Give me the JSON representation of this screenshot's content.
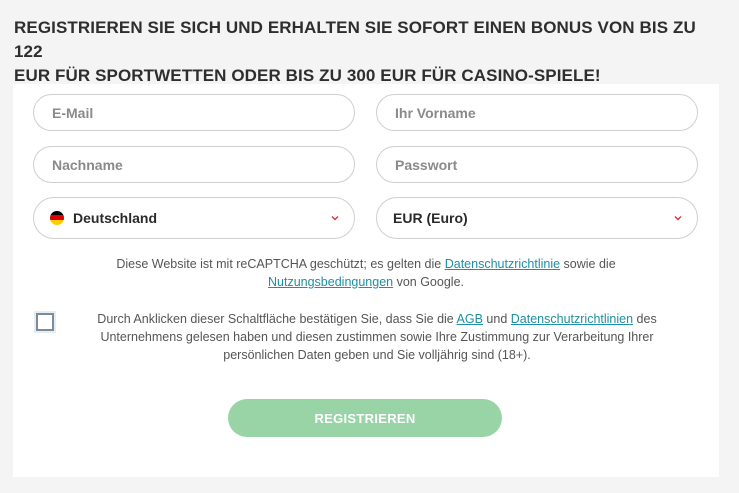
{
  "headline": {
    "line1": "REGISTRIEREN SIE SICH UND ERHALTEN SIE SOFORT EINEN BONUS VON BIS ZU 122",
    "line2": "EUR FÜR SPORTWETTEN ODER BIS ZU 300 EUR FÜR CASINO-SPIELE!"
  },
  "form": {
    "email_placeholder": "E-Mail",
    "firstname_placeholder": "Ihr Vorname",
    "lastname_placeholder": "Nachname",
    "password_placeholder": "Passwort",
    "country_value": "Deutschland",
    "currency_value": "EUR (Euro)",
    "register_label": "REGISTRIEREN"
  },
  "recaptcha": {
    "prefix": "Diese Website ist mit reCAPTCHA geschützt; es gelten die ",
    "privacy_link": "Datenschutzrichtlinie",
    "middle": " sowie die",
    "terms_link": "Nutzungsbedingungen",
    "suffix": " von Google."
  },
  "consent": {
    "prefix": "Durch Anklicken dieser Schaltfläche bestätigen Sie, dass Sie die ",
    "agb_link": "AGB",
    "and": " und ",
    "privacy_link": "Datenschutzrichtlinien",
    "suffix_line1": " des",
    "line2": "Unternehmens gelesen haben und diesen zustimmen sowie Ihre Zustimmung zur Verarbeitung Ihrer",
    "line3": "persönlichen Daten geben und Sie volljährig sind (18+)."
  },
  "colors": {
    "accent_link": "#1f8fa2",
    "register_button": "#98d4a6",
    "chevron": "#d9363e",
    "flag_black": "#000000",
    "flag_red": "#dd0000",
    "flag_gold": "#ffce00"
  },
  "icons": {
    "country_flag": "germany-flag-icon",
    "dropdown": "chevron-down-icon"
  }
}
